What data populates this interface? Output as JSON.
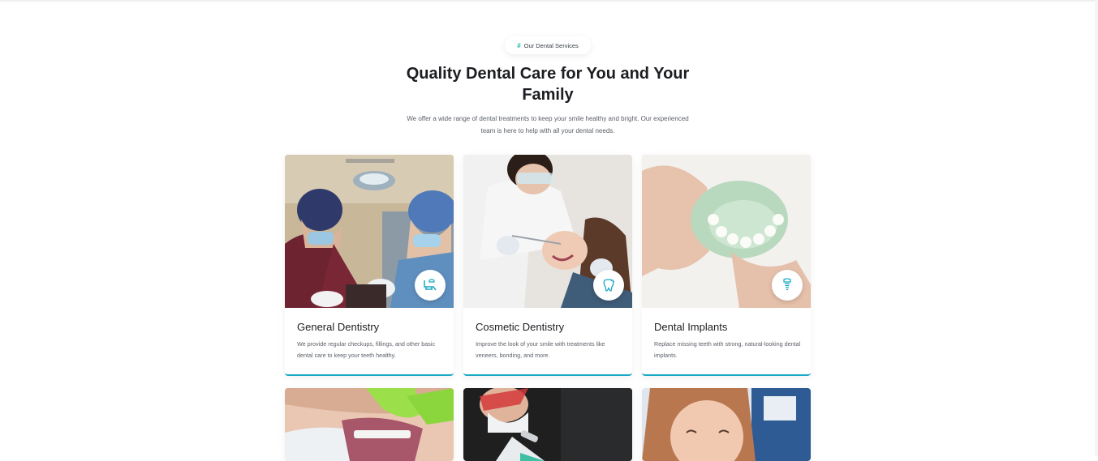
{
  "section": {
    "tag_label": "Our Dental Services",
    "tag_symbol": "#",
    "title": "Quality Dental Care for You and Your Family",
    "subtitle": "We offer a wide range of dental treatments to keep your smile healthy and bright. Our experienced team is here to help with all your dental needs."
  },
  "services": [
    {
      "title": "General Dentistry",
      "description": "We provide regular checkups, fillings, and other basic dental care to keep your teeth healthy.",
      "icon": "dental-chair-icon"
    },
    {
      "title": "Cosmetic Dentistry",
      "description": "Improve the look of your smile with treatments like veneers, bonding, and more.",
      "icon": "tooth-sparkle-icon"
    },
    {
      "title": "Dental Implants",
      "description": "Replace missing teeth with strong, natural-looking dental implants.",
      "icon": "dental-implant-icon"
    }
  ],
  "colors": {
    "accent": "#1aa9c4",
    "tag_accent": "#14b8a6",
    "heading": "#1b1d21",
    "body_text": "#5b6068"
  }
}
